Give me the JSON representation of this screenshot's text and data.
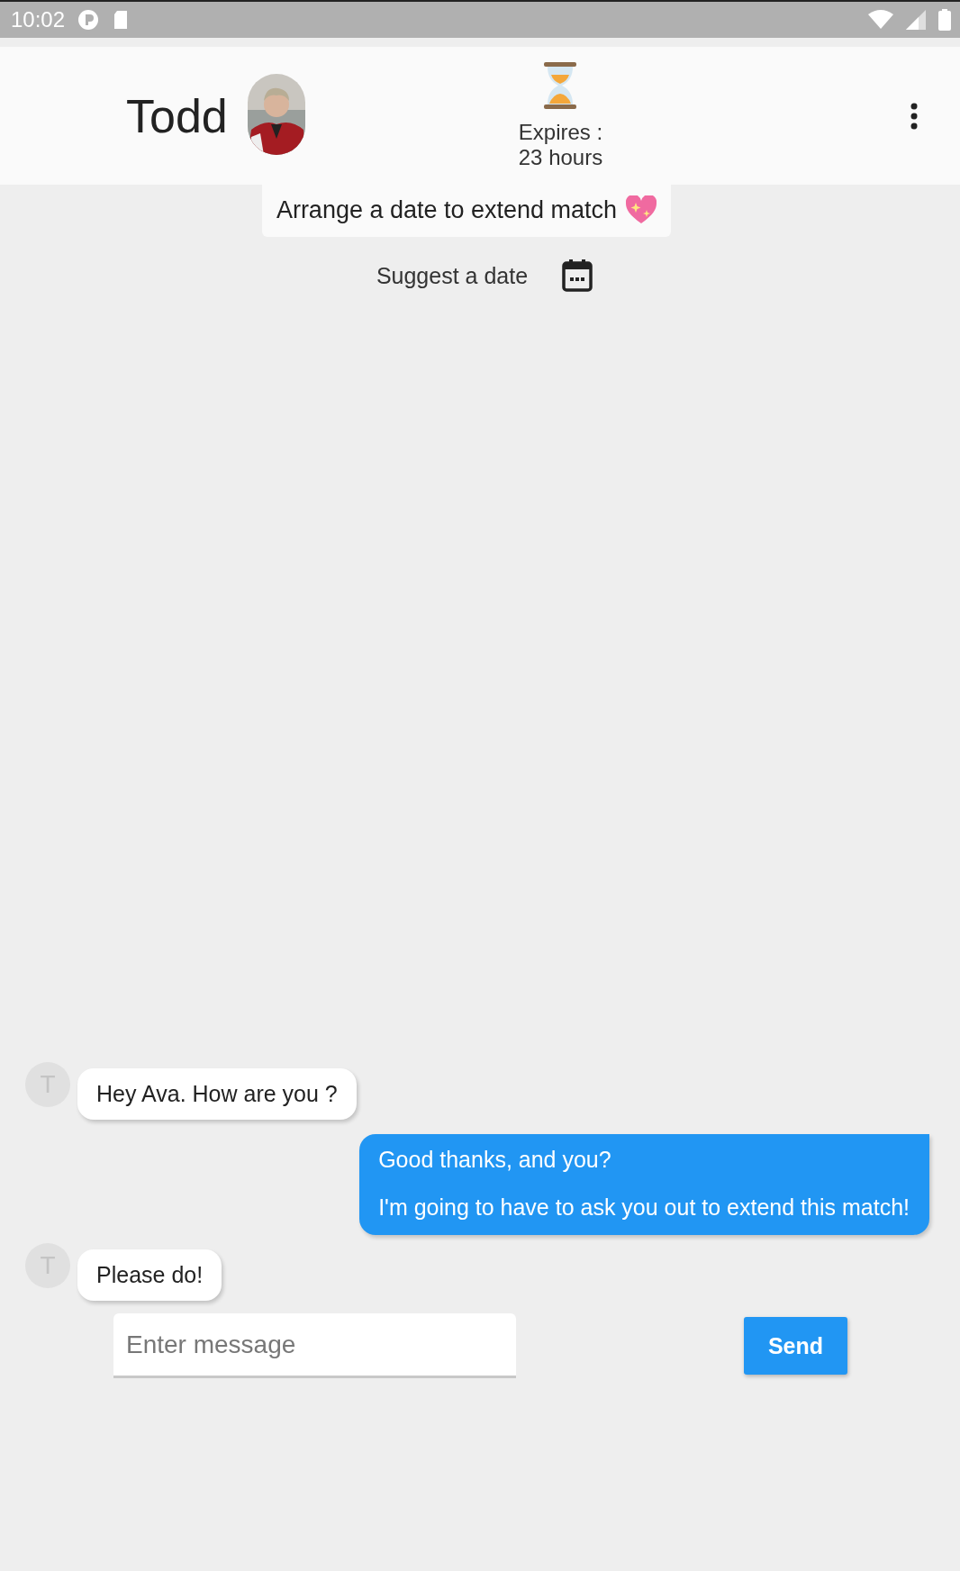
{
  "status_bar": {
    "time": "10:02"
  },
  "header": {
    "name": "Todd",
    "expiry_label": "Expires :",
    "expiry_value": "23 hours"
  },
  "banner": {
    "text": "Arrange a date to extend match"
  },
  "suggest": {
    "label": "Suggest a date"
  },
  "messages": [
    {
      "kind": "received",
      "avatar": "T",
      "paragraphs": [
        "Hey Ava. How are you ?"
      ]
    },
    {
      "kind": "sent",
      "paragraphs": [
        "Good thanks, and you?",
        "I'm going to have to ask you out to extend this match!"
      ]
    },
    {
      "kind": "received",
      "avatar": "T",
      "paragraphs": [
        "Please do!"
      ]
    }
  ],
  "composer": {
    "placeholder": "Enter message",
    "send": "Send"
  }
}
